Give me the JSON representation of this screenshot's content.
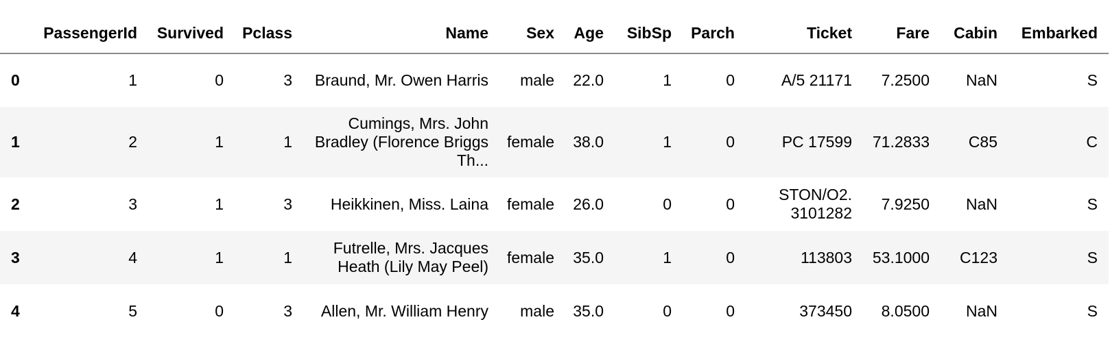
{
  "dataframe": {
    "columns": [
      "",
      "PassengerId",
      "Survived",
      "Pclass",
      "Name",
      "Sex",
      "Age",
      "SibSp",
      "Parch",
      "Ticket",
      "Fare",
      "Cabin",
      "Embarked"
    ],
    "rows": [
      {
        "index": "0",
        "PassengerId": "1",
        "Survived": "0",
        "Pclass": "3",
        "Name": "Braund, Mr. Owen Harris",
        "Sex": "male",
        "Age": "22.0",
        "SibSp": "1",
        "Parch": "0",
        "Ticket": "A/5 21171",
        "Fare": "7.2500",
        "Cabin": "NaN",
        "Embarked": "S"
      },
      {
        "index": "1",
        "PassengerId": "2",
        "Survived": "1",
        "Pclass": "1",
        "Name": "Cumings, Mrs. John Bradley (Florence Briggs Th...",
        "Sex": "female",
        "Age": "38.0",
        "SibSp": "1",
        "Parch": "0",
        "Ticket": "PC 17599",
        "Fare": "71.2833",
        "Cabin": "C85",
        "Embarked": "C"
      },
      {
        "index": "2",
        "PassengerId": "3",
        "Survived": "1",
        "Pclass": "3",
        "Name": "Heikkinen, Miss. Laina",
        "Sex": "female",
        "Age": "26.0",
        "SibSp": "0",
        "Parch": "0",
        "Ticket": "STON/O2. 3101282",
        "Fare": "7.9250",
        "Cabin": "NaN",
        "Embarked": "S"
      },
      {
        "index": "3",
        "PassengerId": "4",
        "Survived": "1",
        "Pclass": "1",
        "Name": "Futrelle, Mrs. Jacques Heath (Lily May Peel)",
        "Sex": "female",
        "Age": "35.0",
        "SibSp": "1",
        "Parch": "0",
        "Ticket": "113803",
        "Fare": "53.1000",
        "Cabin": "C123",
        "Embarked": "S"
      },
      {
        "index": "4",
        "PassengerId": "5",
        "Survived": "0",
        "Pclass": "3",
        "Name": "Allen, Mr. William Henry",
        "Sex": "male",
        "Age": "35.0",
        "SibSp": "0",
        "Parch": "0",
        "Ticket": "373450",
        "Fare": "8.0500",
        "Cabin": "NaN",
        "Embarked": "S"
      }
    ]
  },
  "colors": {
    "stripe_row": "#f5f5f5",
    "header_rule": "#8a8a8a",
    "text": "#000000"
  }
}
